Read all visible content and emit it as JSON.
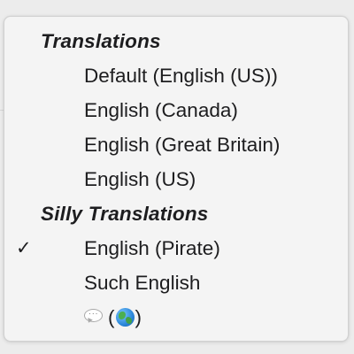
{
  "menu": {
    "sections": [
      {
        "header": "Translations",
        "items": [
          {
            "label": "Default (English (US))",
            "checked": false
          },
          {
            "label": "English (Canada)",
            "checked": false
          },
          {
            "label": "English (Great Britain)",
            "checked": false
          },
          {
            "label": "English (US)",
            "checked": false
          }
        ]
      },
      {
        "header": "Silly Translations",
        "items": [
          {
            "label": "English (Pirate)",
            "checked": true
          },
          {
            "label": "Such English",
            "checked": false
          },
          {
            "label": "",
            "checked": false,
            "icons": [
              "speech-bubble-icon",
              "globe-icon"
            ],
            "open_paren": "(",
            "close_paren": ")"
          }
        ]
      }
    ],
    "checkmark": "✓"
  }
}
